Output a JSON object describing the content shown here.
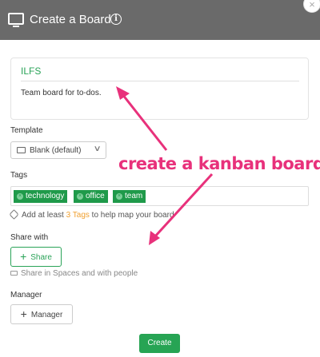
{
  "header": {
    "title": "Create a Board",
    "info_icon": "info-icon",
    "board_icon": "board-icon",
    "close_glyph": "×"
  },
  "board": {
    "name": "ILFS",
    "description": "Team board for to-dos."
  },
  "template": {
    "label": "Template",
    "value": "Blank (default)"
  },
  "tags": {
    "label": "Tags",
    "items": [
      "technology",
      "office",
      "team"
    ],
    "hint_prefix": "Add at least",
    "hint_count": "3 Tags",
    "hint_suffix": "to help map your board"
  },
  "share": {
    "label": "Share with",
    "button": "Share",
    "note": "Share in Spaces and with people"
  },
  "manager": {
    "label": "Manager",
    "button": "Manager"
  },
  "actions": {
    "create": "Create"
  },
  "annotation": {
    "text": "create a kanban board"
  },
  "colors": {
    "header_bg": "#6a6a6a",
    "accent_green": "#2aa358",
    "tag_bg": "#1f9a4a",
    "annotation_pink": "#e8317b",
    "hint_orange": "#f0a030"
  }
}
